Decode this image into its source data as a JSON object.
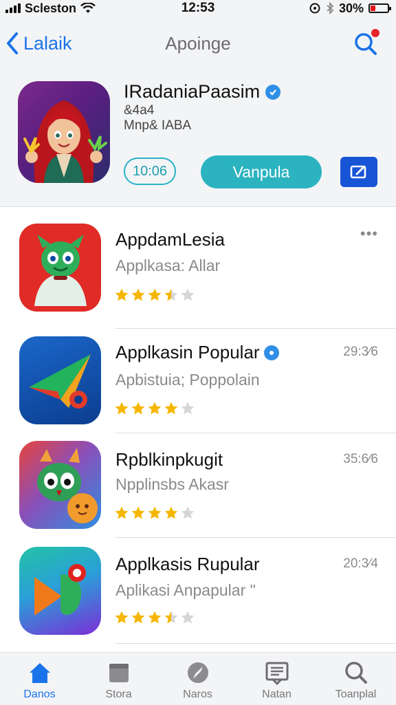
{
  "status_bar": {
    "carrier": "Scleston",
    "time": "12:53",
    "battery": "30%",
    "battery_level": 0.3
  },
  "nav": {
    "back_label": "Lalaik",
    "title": "Apoinge"
  },
  "featured": {
    "name": "IRadaniaPaasim",
    "line1": "&4a4",
    "line2": "Mnp& IABA",
    "time_chip": "10:06",
    "get_label": "Vanpula",
    "icon": "character-girl-red-hair"
  },
  "apps": [
    {
      "title": "AppdamLesia",
      "subtitle": "Applkasa: Allar",
      "meta": "•••",
      "rating": 3.5,
      "verified": false,
      "icon": "green-monster-red-bg"
    },
    {
      "title": "Applkasin Popular",
      "subtitle": "Apbistuia; Poppolain",
      "meta": "29:3⁄6",
      "rating": 4,
      "verified": true,
      "icon": "paper-plane-blue-bg"
    },
    {
      "title": "Rpblkinpkugit",
      "subtitle": "Npplinsbs Akasr",
      "meta": "35:6⁄6",
      "rating": 4,
      "verified": false,
      "icon": "bird-gradient-bg"
    },
    {
      "title": "Applkasis Rupular",
      "subtitle": "Aplikasi Anpapular \"",
      "meta": "20:3⁄4",
      "rating": 3.5,
      "verified": false,
      "icon": "play-arrow-teal-purple-bg"
    }
  ],
  "tabs": [
    {
      "label": "Danos",
      "icon": "home-icon",
      "active": true
    },
    {
      "label": "Stora",
      "icon": "store-icon",
      "active": false
    },
    {
      "label": "Naros",
      "icon": "compass-icon",
      "active": false
    },
    {
      "label": "Natan",
      "icon": "news-icon",
      "active": false
    },
    {
      "label": "Toanplal",
      "icon": "search-icon",
      "active": false
    }
  ],
  "colors": {
    "accent": "#1a73e8",
    "get_button": "#2bb3c0",
    "edit_button": "#1754d6",
    "star": "#f5b600",
    "star_empty": "#d6d6d6"
  }
}
